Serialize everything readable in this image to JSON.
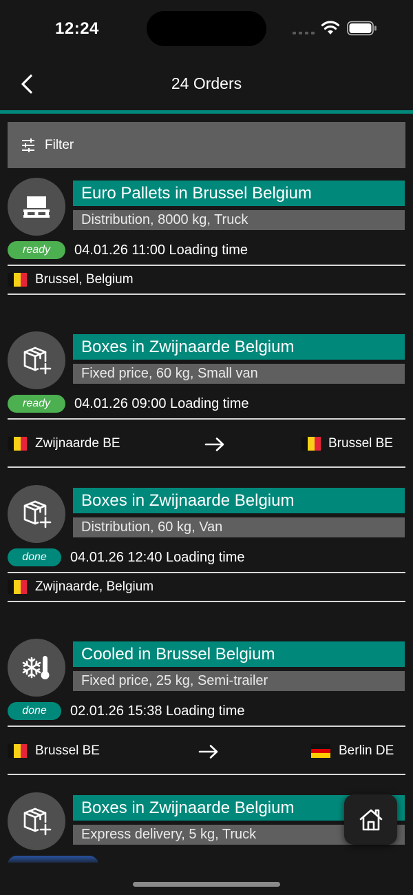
{
  "status": {
    "time": "12:24"
  },
  "header": {
    "title": "24 Orders",
    "back_icon": "chevron-left-icon"
  },
  "filter": {
    "label": "Filter",
    "icon": "sliders-icon"
  },
  "colors": {
    "accent": "#00897b",
    "ready": "#4caf50",
    "done": "#00897b",
    "other": "#2f6bd6",
    "panel": "#5f5f5f",
    "background": "#171717"
  },
  "orders": [
    {
      "icon": "pallet-icon",
      "title": "Euro Pallets in Brussel Belgium",
      "subtitle": "Distribution, 8000 kg, Truck",
      "status": "ready",
      "time": "04.01.26 11:00 Loading time",
      "from": {
        "flag": "BE",
        "text": "Brussel, Belgium"
      }
    },
    {
      "icon": "box-plus-icon",
      "title": "Boxes in Zwijnaarde Belgium",
      "subtitle": "Fixed price, 60 kg, Small van",
      "status": "ready",
      "time": "04.01.26 09:00 Loading time",
      "from": {
        "flag": "BE",
        "text": "Zwijnaarde BE"
      },
      "to": {
        "flag": "BE",
        "text": "Brussel BE"
      }
    },
    {
      "icon": "box-plus-icon",
      "title": "Boxes in Zwijnaarde Belgium",
      "subtitle": "Distribution, 60 kg, Van",
      "status": "done",
      "time": "04.01.26 12:40 Loading time",
      "from": {
        "flag": "BE",
        "text": "Zwijnaarde, Belgium"
      }
    },
    {
      "icon": "snowflake-thermometer-icon",
      "title": "Cooled in Brussel Belgium",
      "subtitle": "Fixed price, 25 kg, Semi-trailer",
      "status": "done",
      "time": "02.01.26 15:38 Loading time",
      "from": {
        "flag": "BE",
        "text": "Brussel BE"
      },
      "to": {
        "flag": "DE",
        "text": "Berlin DE"
      }
    },
    {
      "icon": "box-plus-icon",
      "title": "Boxes in Zwijnaarde Belgium",
      "subtitle": "Express delivery, 5 kg, Truck",
      "status": "",
      "time": ""
    }
  ],
  "fab": {
    "icon": "home-icon"
  }
}
